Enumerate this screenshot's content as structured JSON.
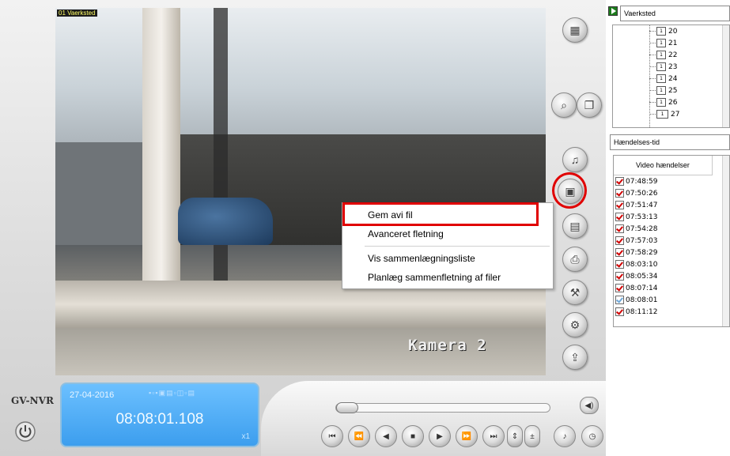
{
  "video": {
    "camera_label": "01 Vaerksted",
    "osd_text": "Kamera 2"
  },
  "context_menu": {
    "items": [
      {
        "label": "Gem avi fil"
      },
      {
        "label": "Avanceret fletning"
      },
      {
        "label": "Vis sammenlægningsliste"
      },
      {
        "label": "Planlæg sammenfletning af filer"
      }
    ]
  },
  "status_display": {
    "date": "27-04-2016",
    "time": "08:08:01.108",
    "speed": "x1"
  },
  "brand": "GV-NVR",
  "right_buttons": [
    {
      "icon": "camera-grid-icon"
    },
    {
      "icon": "search-icon"
    },
    {
      "icon": "copy-icon"
    },
    {
      "icon": "adjust-icon"
    },
    {
      "icon": "save-avi-icon"
    },
    {
      "icon": "save-icon"
    },
    {
      "icon": "print-icon"
    },
    {
      "icon": "tools-icon"
    },
    {
      "icon": "settings-icon"
    },
    {
      "icon": "export-icon"
    }
  ],
  "playback_buttons": [
    {
      "icon": "skip-start-icon"
    },
    {
      "icon": "previous-icon"
    },
    {
      "icon": "rewind-icon"
    },
    {
      "icon": "stop-icon"
    },
    {
      "icon": "play-icon"
    },
    {
      "icon": "next-icon"
    },
    {
      "icon": "skip-end-icon"
    },
    {
      "icon": "speed-stepper-icon"
    },
    {
      "icon": "zoom-icon"
    },
    {
      "icon": "audio-icon"
    },
    {
      "icon": "clock-icon"
    }
  ],
  "sidebar": {
    "location_select": "Vaerksted",
    "dates": [
      {
        "label": "20"
      },
      {
        "label": "21"
      },
      {
        "label": "22"
      },
      {
        "label": "23"
      },
      {
        "label": "24"
      },
      {
        "label": "25"
      },
      {
        "label": "26"
      },
      {
        "label": "27"
      }
    ],
    "event_type_select": "Hændelses-tid",
    "events_header": "Video hændelser",
    "events": [
      {
        "time": "07:48:59",
        "checked": true
      },
      {
        "time": "07:50:26",
        "checked": true
      },
      {
        "time": "07:51:47",
        "checked": true
      },
      {
        "time": "07:53:13",
        "checked": true
      },
      {
        "time": "07:54:28",
        "checked": true
      },
      {
        "time": "07:57:03",
        "checked": true
      },
      {
        "time": "07:58:29",
        "checked": true
      },
      {
        "time": "08:03:10",
        "checked": true
      },
      {
        "time": "08:05:34",
        "checked": true
      },
      {
        "time": "08:07:14",
        "checked": true
      },
      {
        "time": "08:08:01",
        "checked": false
      },
      {
        "time": "08:11:12",
        "checked": true
      }
    ]
  },
  "colors": {
    "highlight": "#e00000",
    "lcd_blue": "#3c9eee"
  }
}
